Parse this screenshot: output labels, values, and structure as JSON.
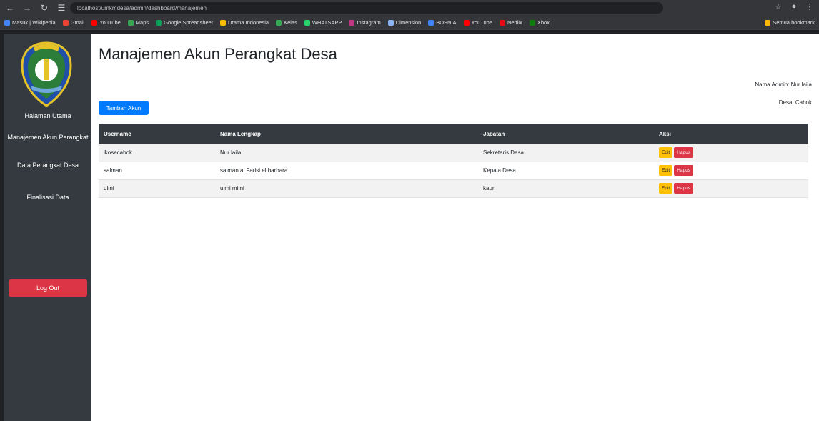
{
  "browser": {
    "url": "localhost/umkmdesa/admin/dashboard/manajemen",
    "bookmarks": [
      "Masuk | Wikipedia",
      "Gmail",
      "YouTube",
      "Maps",
      "Google Spreadsheet",
      "Drama Indonesia",
      "Kelas",
      "WHATSAPP",
      "Instagram",
      "Dimension",
      "BOSNIA",
      "YouTube",
      "Netflix",
      "Xbox",
      "Semua bookmark"
    ]
  },
  "sidebar": {
    "items": [
      {
        "label": "Halaman Utama"
      },
      {
        "label": "Manajemen Akun Perangkat"
      },
      {
        "label": "Data Perangkat Desa"
      },
      {
        "label": "Finalisasi Data"
      }
    ],
    "logout_label": "Log Out"
  },
  "header": {
    "title": "Manajemen Akun Perangkat Desa",
    "admin_name": "Nama Admin: Nur laila",
    "village": "Desa: Cabok"
  },
  "toolbar": {
    "add_label": "Tambah Akun"
  },
  "table": {
    "columns": [
      "Username",
      "Nama Lengkap",
      "Jabatan",
      "Aksi"
    ],
    "rows": [
      {
        "username": "ikosecabok",
        "fullname": "Nur laila",
        "position": "Sekretaris Desa"
      },
      {
        "username": "salman",
        "fullname": "salman al Farisi el barbara",
        "position": "Kepala Desa"
      },
      {
        "username": "ulmi",
        "fullname": "ulmi mimi",
        "position": "kaur"
      }
    ],
    "edit_label": "Edit",
    "delete_label": "Hapus"
  },
  "colors": {
    "sidebar": "#343a40",
    "primary": "#007bff",
    "danger": "#dc3545",
    "warning": "#ffc107"
  }
}
